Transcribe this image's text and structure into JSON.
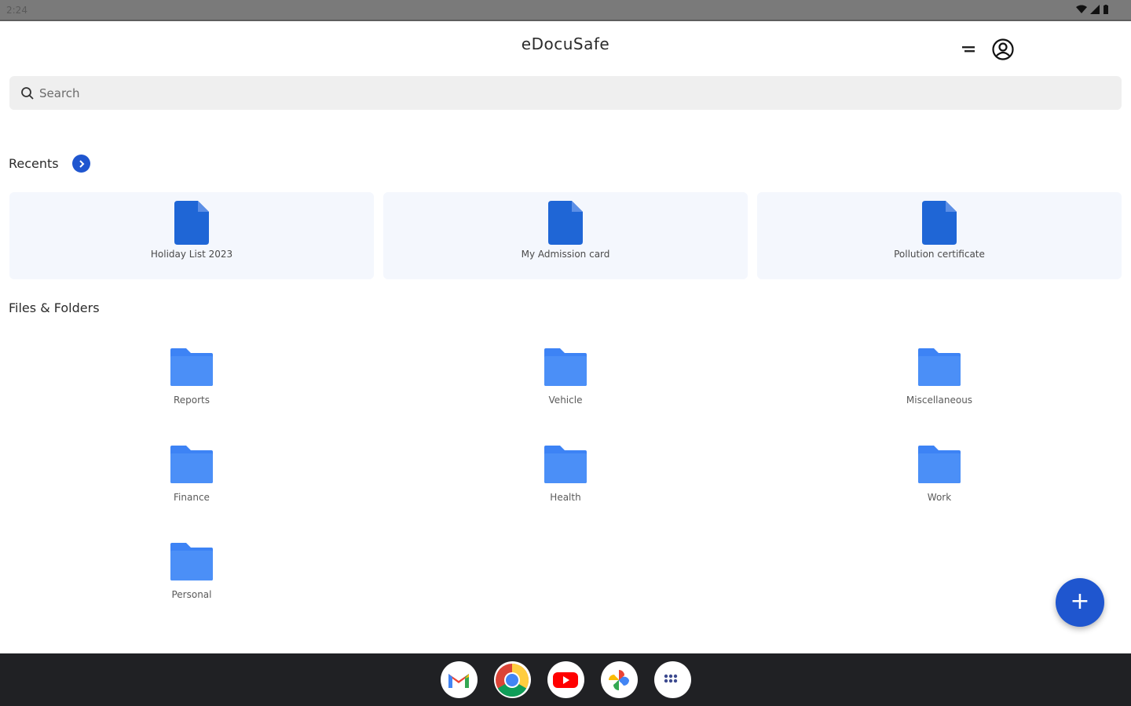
{
  "status_bar": {
    "time": "2:24"
  },
  "header": {
    "app_title": "eDocuSafe"
  },
  "search": {
    "placeholder": "Search"
  },
  "recents": {
    "title": "Recents",
    "items": [
      {
        "label": "Holiday List 2023"
      },
      {
        "label": "My Admission card"
      },
      {
        "label": "Pollution certificate"
      }
    ]
  },
  "files": {
    "title": "Files & Folders",
    "folders": [
      {
        "label": "Reports"
      },
      {
        "label": "Vehicle"
      },
      {
        "label": "Miscellaneous"
      },
      {
        "label": "Finance"
      },
      {
        "label": "Health"
      },
      {
        "label": "Work"
      },
      {
        "label": "Personal"
      }
    ]
  },
  "fab": {
    "label": "+"
  },
  "taskbar": {
    "apps": [
      "gmail-icon",
      "chrome-icon",
      "youtube-icon",
      "photos-icon",
      "app-launcher-icon"
    ]
  },
  "colors": {
    "accent": "#1f56cf",
    "folder": "#3d83f5",
    "document": "#1f66d6"
  }
}
